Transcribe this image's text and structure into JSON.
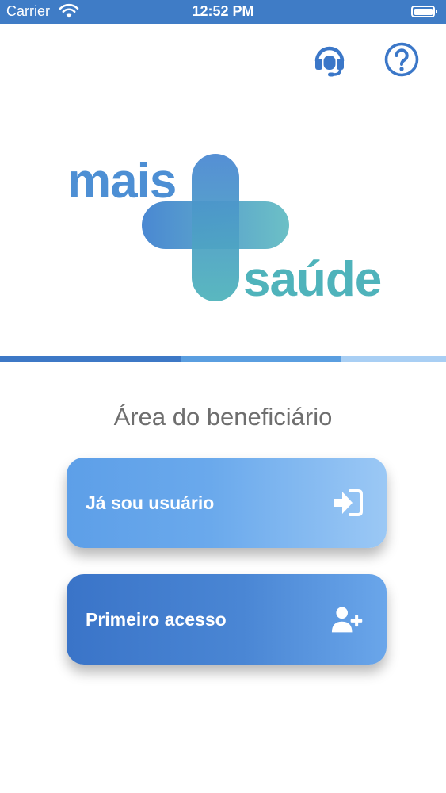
{
  "status_bar": {
    "carrier": "Carrier",
    "time": "12:52 PM",
    "wifi_icon": "wifi-icon",
    "battery_icon": "battery-icon"
  },
  "header": {
    "support_icon": "headset-icon",
    "help_icon": "help-circle-icon"
  },
  "logo": {
    "word_top": "mais",
    "word_bottom": "saúde",
    "colors": {
      "primary_blue": "#4d8fd4",
      "teal": "#4fb3bb"
    }
  },
  "section_title": "Área do beneficiário",
  "buttons": {
    "existing_user": {
      "label": "Já sou usuário",
      "icon": "sign-in-icon"
    },
    "first_access": {
      "label": "Primeiro acesso",
      "icon": "user-plus-icon"
    }
  },
  "colors": {
    "status_bar": "#3f7cc6",
    "accent": "#3b77c8",
    "title_text": "#6e6e6e"
  }
}
